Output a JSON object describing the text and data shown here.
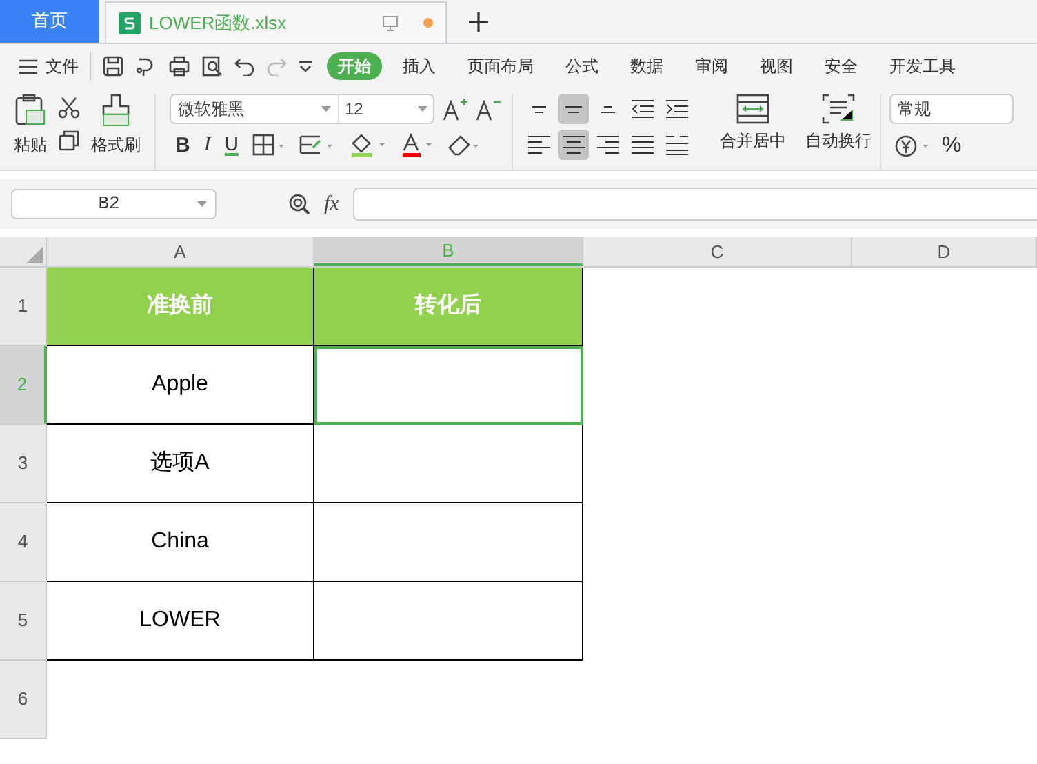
{
  "tabs": [
    {
      "label": "首页",
      "kind": "home",
      "selected": false
    },
    {
      "label": "LOWER函数.xlsx",
      "kind": "doc",
      "selected": true
    }
  ],
  "menu": {
    "file": "文件",
    "items": [
      {
        "label": "开始",
        "selected": true
      },
      {
        "label": "插入",
        "selected": false
      },
      {
        "label": "页面布局",
        "selected": false
      },
      {
        "label": "公式",
        "selected": false
      },
      {
        "label": "数据",
        "selected": false
      },
      {
        "label": "审阅",
        "selected": false
      },
      {
        "label": "视图",
        "selected": false
      },
      {
        "label": "安全",
        "selected": false
      },
      {
        "label": "开发工具",
        "selected": false
      }
    ]
  },
  "ribbon": {
    "paste": "粘贴",
    "format_painter": "格式刷",
    "font_name": "微软雅黑",
    "font_size": "12",
    "bold": "B",
    "italic": "I",
    "underline": "U",
    "align_buttons": [
      {
        "selected": false
      },
      {
        "selected": true
      },
      {
        "selected": false
      },
      {
        "selected": false
      },
      {
        "selected": false
      },
      {
        "selected": false
      },
      {
        "selected": true
      },
      {
        "selected": false
      },
      {
        "selected": false
      },
      {
        "selected": false
      }
    ],
    "merge": "合并居中",
    "wrap": "自动换行",
    "number_format": "常规",
    "percent": "%"
  },
  "formula_bar": {
    "name_box": "B2",
    "fx": "fx"
  },
  "sheet": {
    "columns": [
      {
        "label": "A",
        "selected": false
      },
      {
        "label": "B",
        "selected": true
      },
      {
        "label": "C",
        "selected": false
      },
      {
        "label": "D",
        "selected": false
      }
    ],
    "rows": [
      {
        "label": "1",
        "selected": false,
        "kind": "header",
        "cells": [
          "准换前",
          "转化后"
        ]
      },
      {
        "label": "2",
        "selected": true,
        "kind": "data",
        "cells": [
          "Apple",
          ""
        ]
      },
      {
        "label": "3",
        "selected": false,
        "kind": "data",
        "cells": [
          "选项A",
          ""
        ]
      },
      {
        "label": "4",
        "selected": false,
        "kind": "data",
        "cells": [
          "China",
          ""
        ]
      },
      {
        "label": "5",
        "selected": false,
        "kind": "data",
        "cells": [
          "LOWER",
          ""
        ]
      },
      {
        "label": "6",
        "selected": false,
        "kind": "empty",
        "cells": []
      }
    ]
  }
}
